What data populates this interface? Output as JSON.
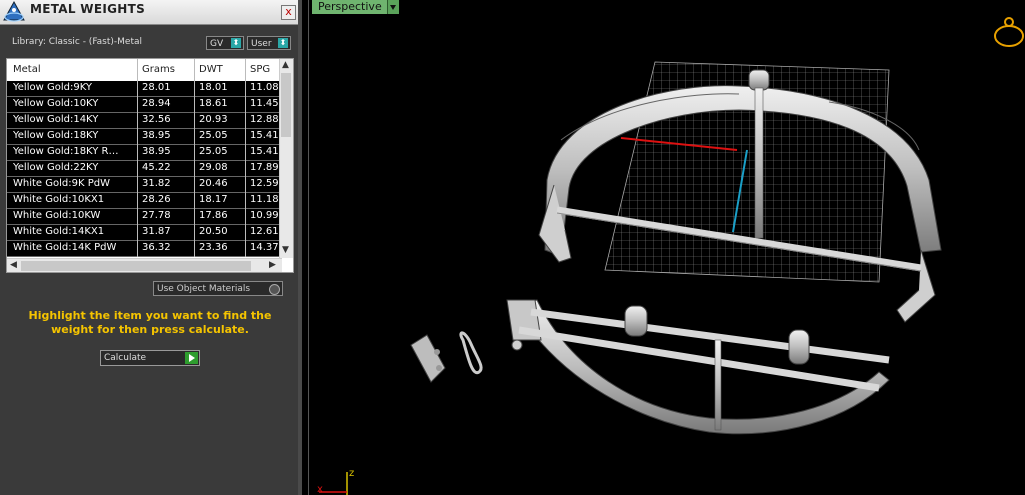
{
  "panel": {
    "title": "METAL WEIGHTS",
    "close_label": "x",
    "library_label": "Library: Classic - (Fast)-Metal",
    "combo_gv": "GV",
    "combo_user": "User",
    "table": {
      "headers": [
        "Metal",
        "Grams",
        "DWT",
        "SPG"
      ],
      "rows": [
        [
          "Yellow Gold:9KY",
          "28.01",
          "18.01",
          "11.08"
        ],
        [
          "Yellow Gold:10KY",
          "28.94",
          "18.61",
          "11.45"
        ],
        [
          "Yellow Gold:14KY",
          "32.56",
          "20.93",
          "12.88"
        ],
        [
          "Yellow Gold:18KY",
          "38.95",
          "25.05",
          "15.41"
        ],
        [
          "Yellow Gold:18KY R…",
          "38.95",
          "25.05",
          "15.41"
        ],
        [
          "Yellow Gold:22KY",
          "45.22",
          "29.08",
          "17.89"
        ],
        [
          "White Gold:9K PdW",
          "31.82",
          "20.46",
          "12.59"
        ],
        [
          "White Gold:10KX1",
          "28.26",
          "18.17",
          "11.18"
        ],
        [
          "White Gold:10KW",
          "27.78",
          "17.86",
          "10.99"
        ],
        [
          "White Gold:14KX1",
          "31.87",
          "20.50",
          "12.61"
        ],
        [
          "White Gold:14K PdW",
          "36.32",
          "23.36",
          "14.37"
        ]
      ]
    },
    "use_object_materials": "Use Object Materials",
    "hint": "Highlight the item you want to find the weight for then press calculate.",
    "calculate_label": "Calculate"
  },
  "viewport": {
    "view_name": "Perspective",
    "axis_z": "z",
    "axis_x": "x"
  },
  "colors": {
    "panel_bg": "#3a3a3a",
    "hint": "#f5c400",
    "vp_tab": "#6fb46f",
    "accent_teal": "#2aa7a7"
  }
}
